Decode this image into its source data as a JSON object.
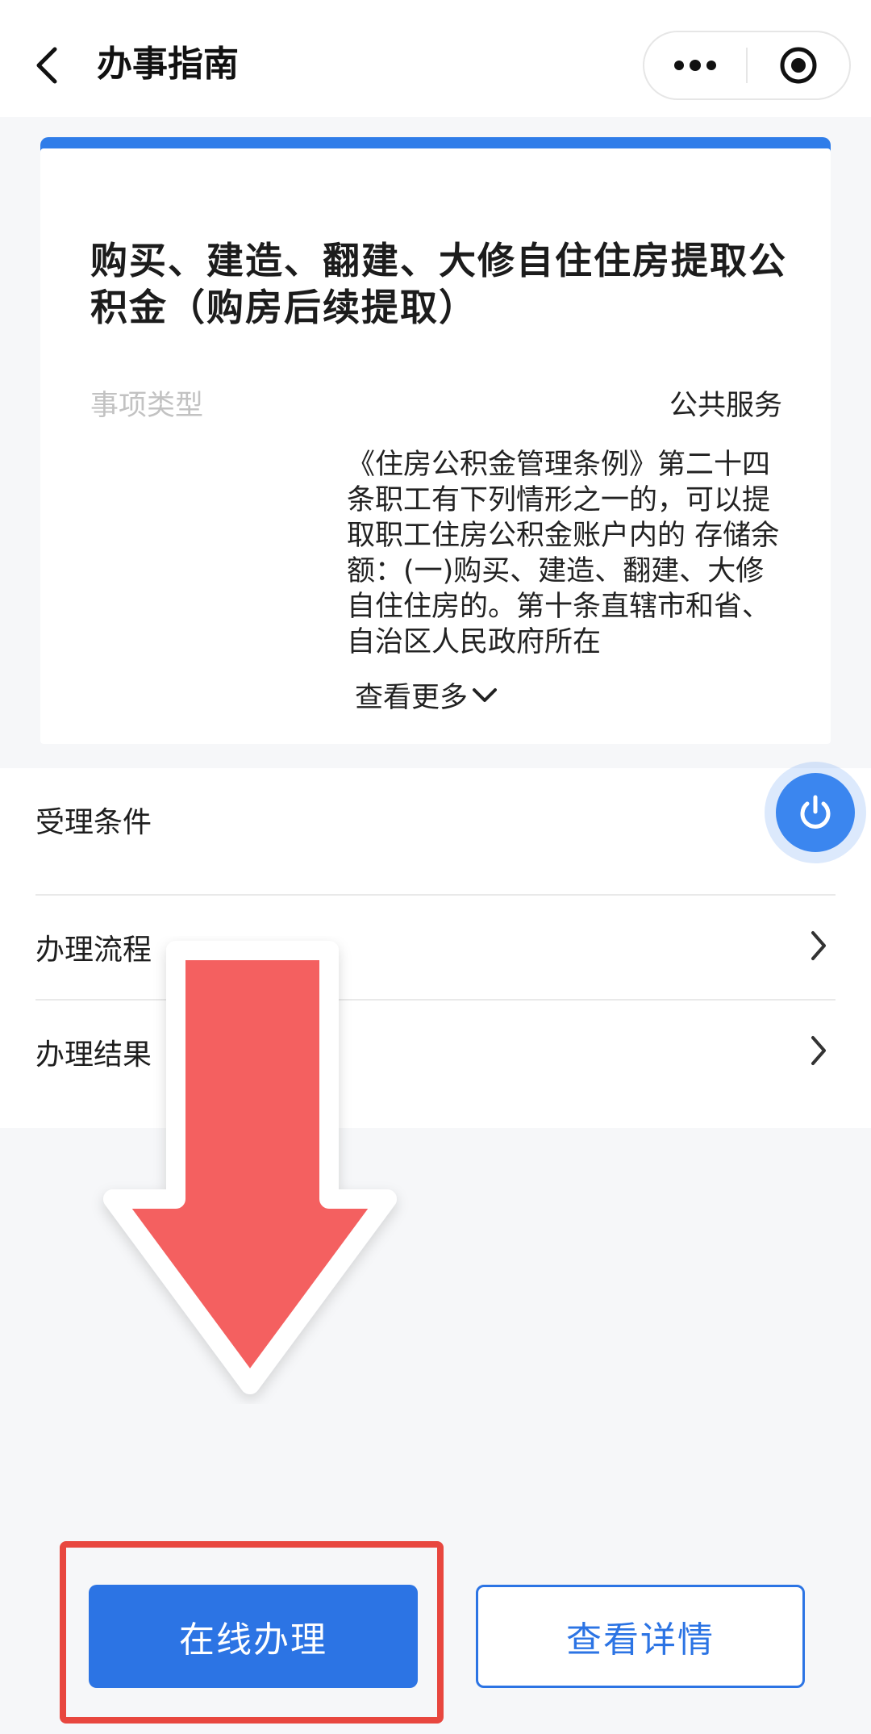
{
  "header": {
    "title": "办事指南",
    "back_icon": "back-chevron-icon",
    "menu_icon": "more-dots-icon",
    "close_icon": "record-target-icon"
  },
  "card": {
    "title": "购买、建造、翻建、大修自住住房提取公积金（购房后续提取）",
    "type_label": "事项类型",
    "type_value": "公共服务",
    "basis_text": "《住房公积金管理条例》第二十四条职工有下列情形之一的，可以提取职工住房公积金账户内的 存储余额：(一)购买、建造、翻建、大修自住住房的。第十条直辖市和省、自治区人民政府所在",
    "more_label": "查看更多"
  },
  "list": {
    "items": [
      {
        "label": "受理条件"
      },
      {
        "label": "办理流程"
      },
      {
        "label": "办理结果"
      }
    ]
  },
  "floating_button": {
    "icon": "power-icon"
  },
  "overlay": {
    "arrow_color": "#f46060"
  },
  "bottom": {
    "primary_label": "在线办理",
    "secondary_label": "查看详情",
    "primary_color": "#2c74e4",
    "highlight_color": "#e8473f"
  }
}
